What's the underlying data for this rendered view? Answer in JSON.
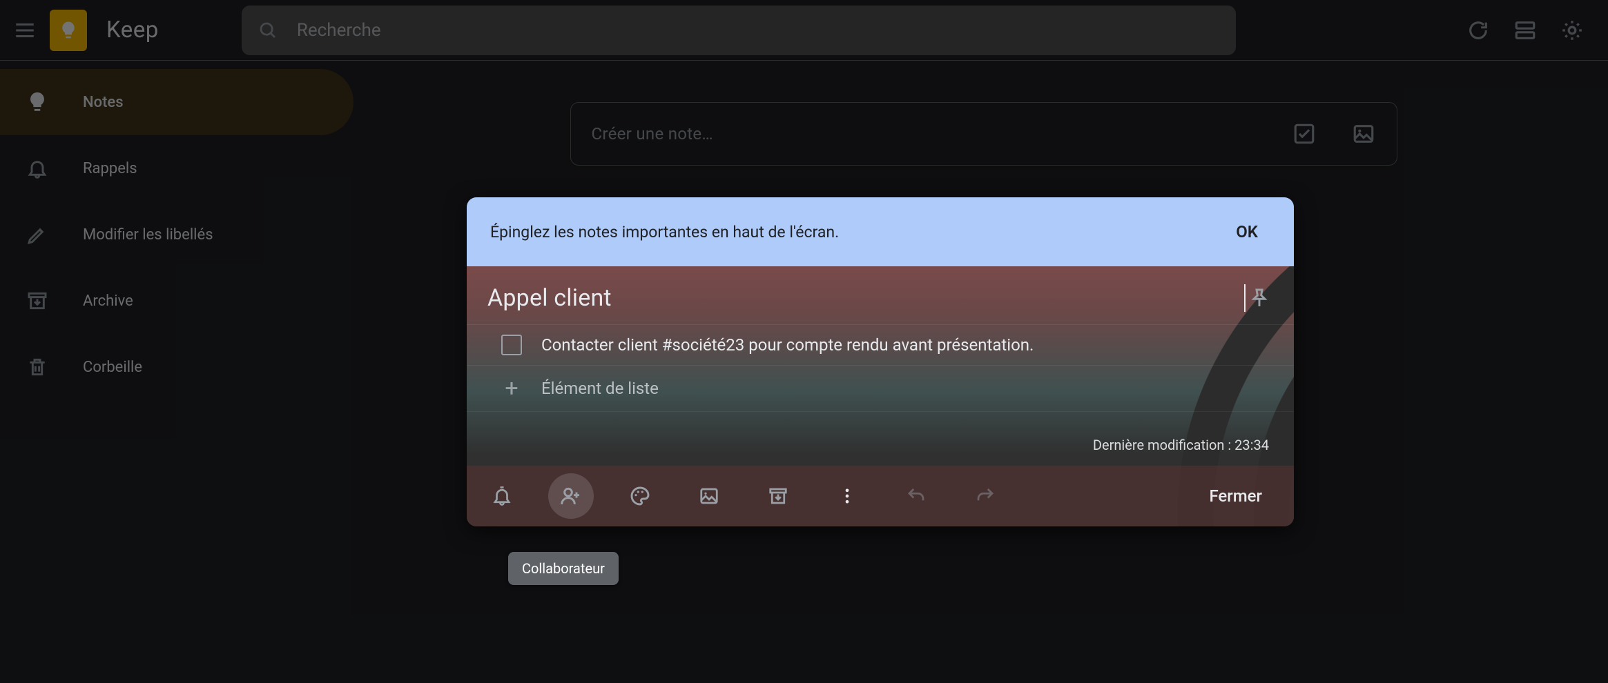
{
  "header": {
    "app_name": "Keep",
    "search_placeholder": "Recherche"
  },
  "sidebar": {
    "items": [
      {
        "label": "Notes"
      },
      {
        "label": "Rappels"
      },
      {
        "label": "Modifier les libellés"
      },
      {
        "label": "Archive"
      },
      {
        "label": "Corbeille"
      }
    ]
  },
  "main": {
    "create_placeholder": "Créer une note…"
  },
  "hint": {
    "text": "Épinglez les notes importantes en haut de l'écran.",
    "ok": "OK"
  },
  "note": {
    "title": "Appel client",
    "items": [
      {
        "text": "Contacter client #société23 pour compte rendu avant présentation.",
        "checked": false
      }
    ],
    "add_item_placeholder": "Élément de liste",
    "last_modified_label": "Dernière modification : 23:34",
    "close_label": "Fermer"
  },
  "tooltip": {
    "collaborator": "Collaborateur"
  }
}
